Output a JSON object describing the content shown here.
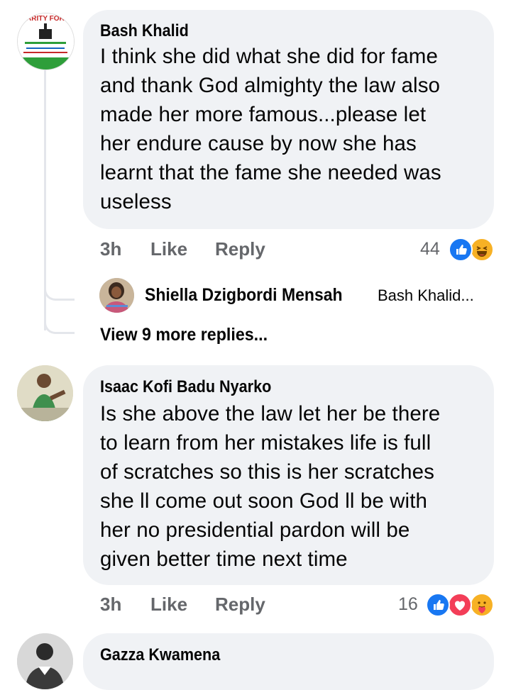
{
  "comments": [
    {
      "author": "Bash Khalid",
      "avatar_text": "ARITY FOR",
      "lines": [
        "I think she did what she did for fame",
        "and thank God almighty the law also",
        "made her more famous...please let",
        "her endure cause by now she has",
        "learnt that the fame she needed was",
        "useless"
      ],
      "time": "3h",
      "like": "Like",
      "reply": "Reply",
      "reaction_count": "44",
      "reactions": [
        "like-icon",
        "haha-icon"
      ]
    },
    {
      "author": "Isaac Kofi Badu Nyarko",
      "lines": [
        "Is she above the law let her be there",
        "to learn from her mistakes life is full",
        "of scratches so this is her scratches",
        "she ll come out soon God ll be with",
        "her no presidential pardon will be",
        "given better time next time"
      ],
      "time": "3h",
      "like": "Like",
      "reply": "Reply",
      "reaction_count": "16",
      "reactions": [
        "like-icon",
        "love-icon",
        "care-icon"
      ]
    },
    {
      "author": "Gazza Kwamena"
    }
  ],
  "reply_preview": {
    "author": "Shiella Dzigbordi Mensah",
    "snippet": "Bash Khalid..."
  },
  "view_more": "View 9 more replies...",
  "colors": {
    "bubble": "#f0f2f5",
    "meta": "#65676b",
    "like_blue": "#1877f2",
    "love_red": "#f33e58",
    "haha_yellow": "#f7b125"
  }
}
